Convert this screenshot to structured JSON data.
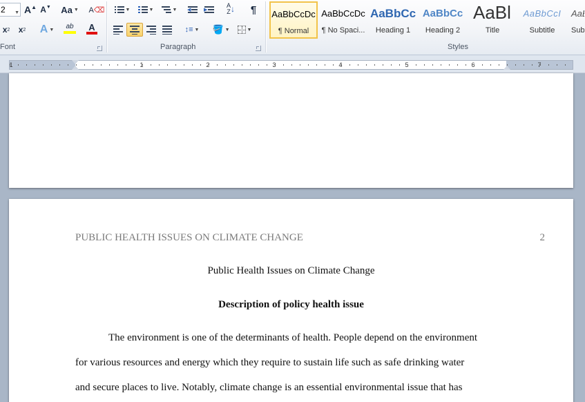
{
  "ribbon": {
    "font": {
      "size_value": "2",
      "grow_label": "A",
      "shrink_label": "A",
      "case_label": "Aa",
      "subscript_label": "x",
      "superscript_label": "x",
      "effects_label": "A",
      "highlight_label": "ab",
      "color_label": "A",
      "group_label": "Font"
    },
    "paragraph": {
      "sort_label": "A↓Z",
      "pilcrow": "¶",
      "group_label": "Paragraph"
    },
    "styles": {
      "items": [
        {
          "preview": "AaBbCcDc",
          "name": "¶ Normal"
        },
        {
          "preview": "AaBbCcDc",
          "name": "¶ No Spaci..."
        },
        {
          "preview": "AaBbCc",
          "name": "Heading 1"
        },
        {
          "preview": "AaBbCc",
          "name": "Heading 2"
        },
        {
          "preview": "AaBl",
          "name": "Title"
        },
        {
          "preview": "AaBbCcI",
          "name": "Subtitle"
        },
        {
          "preview": "AaB",
          "name": "Sub"
        }
      ],
      "group_label": "Styles"
    },
    "colors": {
      "highlight": "#ffff00",
      "font_color": "#e01010",
      "active": "#f8d26b"
    }
  },
  "ruler": {
    "numbers": [
      "1",
      "1",
      "2",
      "3",
      "4",
      "5",
      "6",
      "7"
    ]
  },
  "document": {
    "header": "PUBLIC HEALTH ISSUES ON CLIMATE CHANGE",
    "page_number": "2",
    "title": "Public Health Issues on Climate Change",
    "heading": "Description of policy health issue",
    "lines": [
      "The environment is one of the determinants of health. People depend on the environment",
      "for various resources and energy which they require to sustain life such as safe drinking water",
      "and secure places to live. Notably, climate change is an essential environmental issue that has"
    ]
  }
}
